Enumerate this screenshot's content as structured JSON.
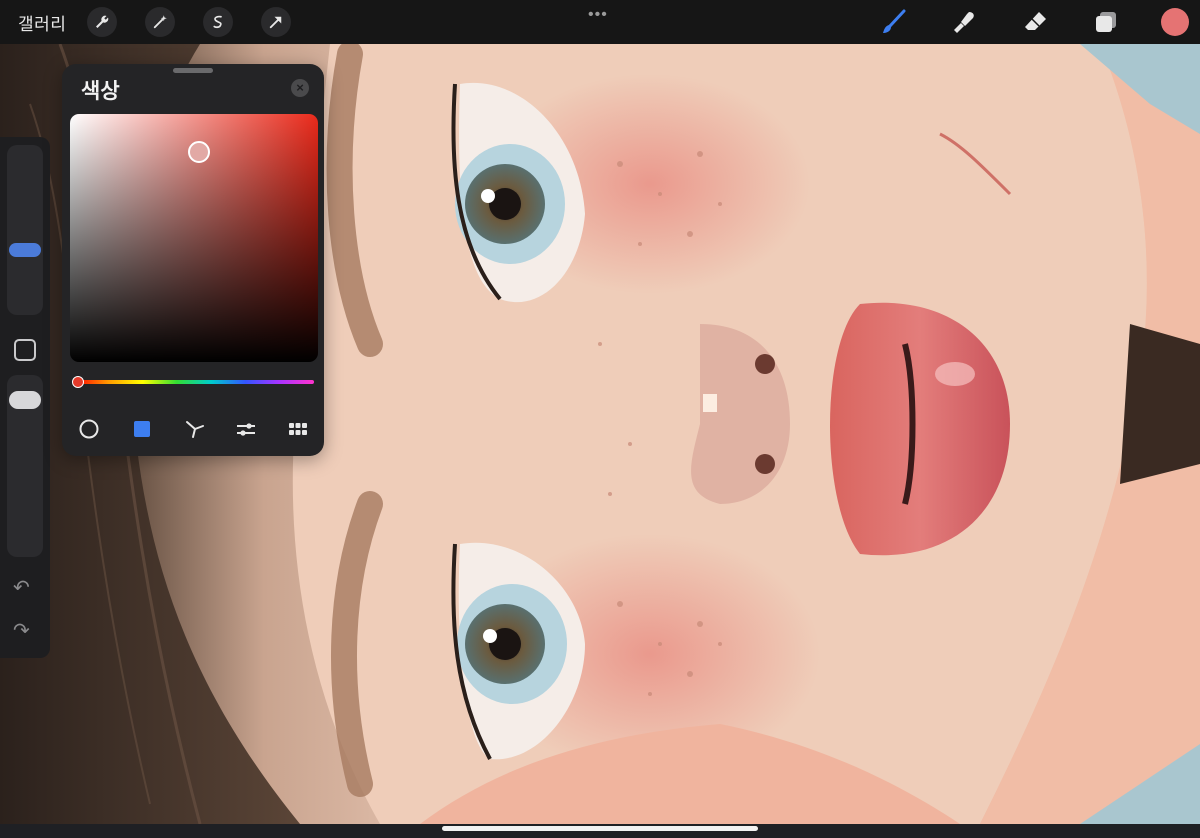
{
  "topbar": {
    "gallery_label": "갤러리",
    "action_buttons": [
      {
        "name": "wrench-icon"
      },
      {
        "name": "magic-wand-icon"
      },
      {
        "name": "selection-icon"
      },
      {
        "name": "transform-arrow-icon"
      }
    ],
    "more_dots": "•••",
    "tools": [
      {
        "name": "brush-icon",
        "active": true
      },
      {
        "name": "smudge-icon",
        "active": false
      },
      {
        "name": "eraser-icon",
        "active": false
      },
      {
        "name": "layers-icon",
        "active": false
      }
    ],
    "current_color": "#e57373"
  },
  "sidebar": {
    "brush_size_level": 0.63,
    "opacity_level": 0.1,
    "modify_icon": "square-icon",
    "undo_icon": "undo-icon",
    "redo_icon": "redo-icon"
  },
  "color_panel": {
    "title": "색상",
    "close_icon": "close-icon",
    "hue_color": "#ea2a1b",
    "selected_color": "#e2a9a5",
    "hue_position": 0.0,
    "modes": [
      {
        "name": "disc-mode-icon",
        "active": false
      },
      {
        "name": "classic-mode-icon",
        "active": true
      },
      {
        "name": "harmony-mode-icon",
        "active": false
      },
      {
        "name": "value-mode-icon",
        "active": false
      },
      {
        "name": "palettes-mode-icon",
        "active": false
      }
    ]
  },
  "colors": {
    "accent_blue": "#3d7ef0",
    "panel_bg": "#242426"
  }
}
